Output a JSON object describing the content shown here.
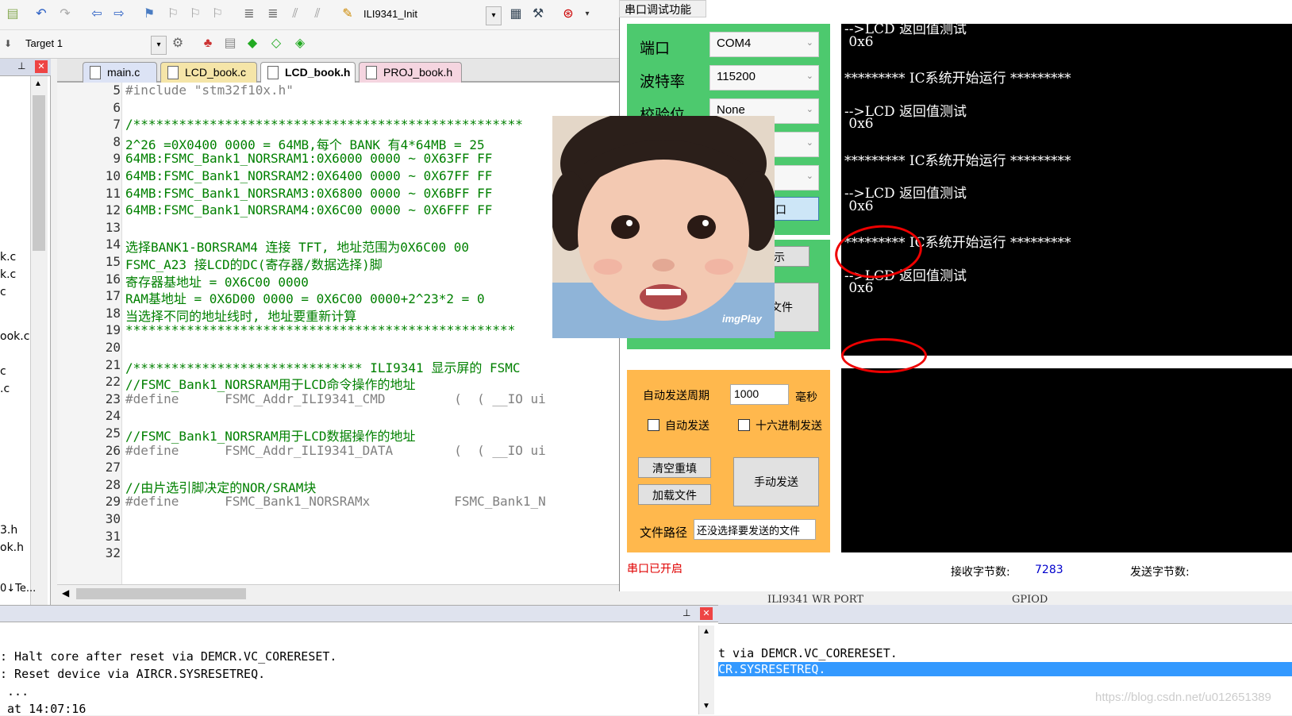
{
  "ide": {
    "toolbar_target_combo": "ILI9341_Init",
    "target_name": "Target 1",
    "tabs": [
      "main.c",
      "LCD_book.c",
      "LCD_book.h",
      "PROJ_book.h"
    ],
    "active_tab": "LCD_book.h",
    "left_panel_items": [
      "k.c",
      "k.c",
      "c",
      "ook.c",
      "c",
      ".c",
      "3.h",
      "ok.h",
      "0↓Te..."
    ],
    "lines": [
      {
        "n": "5",
        "text": "#include \"stm32f10x.h\"",
        "kind": "include"
      },
      {
        "n": "6",
        "text": "",
        "kind": "code"
      },
      {
        "n": "7",
        "text": "/***************************************************",
        "kind": "comment"
      },
      {
        "n": "8",
        "text": "2^26 =0X0400 0000 = 64MB,每个 BANK 有4*64MB = 25",
        "kind": "comment"
      },
      {
        "n": "9",
        "text": "64MB:FSMC_Bank1_NORSRAM1:0X6000 0000 ~ 0X63FF FF",
        "kind": "comment"
      },
      {
        "n": "10",
        "text": "64MB:FSMC_Bank1_NORSRAM2:0X6400 0000 ~ 0X67FF FF",
        "kind": "comment"
      },
      {
        "n": "11",
        "text": "64MB:FSMC_Bank1_NORSRAM3:0X6800 0000 ~ 0X6BFF FF",
        "kind": "comment"
      },
      {
        "n": "12",
        "text": "64MB:FSMC_Bank1_NORSRAM4:0X6C00 0000 ~ 0X6FFF FF",
        "kind": "comment"
      },
      {
        "n": "13",
        "text": "",
        "kind": "code"
      },
      {
        "n": "14",
        "text": "选择BANK1-BORSRAM4 连接 TFT, 地址范围为0X6C00 00",
        "kind": "comment"
      },
      {
        "n": "15",
        "text": "FSMC_A23 接LCD的DC(寄存器/数据选择)脚",
        "kind": "comment"
      },
      {
        "n": "16",
        "text": "寄存器基地址 = 0X6C00 0000",
        "kind": "comment"
      },
      {
        "n": "17",
        "text": "RAM基地址 = 0X6D00 0000 = 0X6C00 0000+2^23*2 = 0",
        "kind": "comment"
      },
      {
        "n": "18",
        "text": "当选择不同的地址线时, 地址要重新计算",
        "kind": "comment"
      },
      {
        "n": "19",
        "text": "***************************************************",
        "kind": "comment"
      },
      {
        "n": "20",
        "text": "",
        "kind": "code"
      },
      {
        "n": "21",
        "text": "/****************************** ILI9341 显示屏的 FSMC",
        "kind": "comment"
      },
      {
        "n": "22",
        "text": "//FSMC_Bank1_NORSRAM用于LCD命令操作的地址",
        "kind": "comment"
      },
      {
        "n": "23",
        "text": "#define      FSMC_Addr_ILI9341_CMD         (  ( __IO ui",
        "kind": "define"
      },
      {
        "n": "24",
        "text": "",
        "kind": "code"
      },
      {
        "n": "25",
        "text": "//FSMC_Bank1_NORSRAM用于LCD数据操作的地址",
        "kind": "comment"
      },
      {
        "n": "26",
        "text": "#define      FSMC_Addr_ILI9341_DATA        (  ( __IO ui",
        "kind": "define"
      },
      {
        "n": "27",
        "text": "",
        "kind": "code"
      },
      {
        "n": "28",
        "text": "//由片选引脚决定的NOR/SRAM块",
        "kind": "comment"
      },
      {
        "n": "29",
        "text": "#define      FSMC_Bank1_NORSRAMx           FSMC_Bank1_N",
        "kind": "define"
      },
      {
        "n": "30",
        "text": "",
        "kind": "code"
      },
      {
        "n": "31",
        "text": "",
        "kind": "code"
      },
      {
        "n": "32",
        "text": "",
        "kind": "code"
      }
    ],
    "output_lines": [
      ": Halt core after reset via DEMCR.VC_CORERESET.",
      ": Reset device via AIRCR.SYSRESETREQ.",
      " ...",
      " at 14:07:16"
    ],
    "right_output_lines": [
      "t via DEMCR.VC_CORERESET.",
      "CR.SYSRESETREQ."
    ],
    "behind_text": [
      "ILI9341 WR PORT",
      "GPIOD"
    ]
  },
  "serial": {
    "title": "串口调试功能",
    "port_label": "端口",
    "port_value": "COM4",
    "baud_label": "波特率",
    "baud_value": "115200",
    "parity_label": "校验位",
    "parity_value": "None",
    "open_button_partial": "串口",
    "display_button_partial": "止显示",
    "redirect_button_partial": "转向文件",
    "auto_period_label": "自动发送周期",
    "auto_period_value": "1000",
    "ms_label": "毫秒",
    "auto_send_label": "自动发送",
    "hex_send_label": "十六进制发送",
    "clear_button": "清空重填",
    "load_button": "加载文件",
    "manual_send_button": "手动发送",
    "file_path_label": "文件路径",
    "file_path_value": "还没选择要发送的文件",
    "status_text": "串口已开启",
    "recv_label": "接收字节数:",
    "recv_value": "7283",
    "send_label": "发送字节数:",
    "terminal_lines": [
      "-->LCD 返回值测试",
      " 0x6",
      "",
      "********* IC系统开始运行 *********",
      "",
      "-->LCD 返回值测试",
      " 0x6",
      "",
      "********* IC系统开始运行 *********",
      "",
      "-->LCD 返回值测试",
      " 0x6",
      "",
      "********* IC系统开始运行 *********",
      "",
      "-->LCD 返回值测试",
      " 0x6"
    ]
  },
  "overlay": {
    "photo_caption": "imgPlay"
  },
  "watermark": "https://blog.csdn.net/u012651389",
  "colors": {
    "green_panel": "#4dc96e",
    "orange_panel": "#ffb84d",
    "status_red": "#e00000",
    "recv_blue": "#0000cc"
  }
}
